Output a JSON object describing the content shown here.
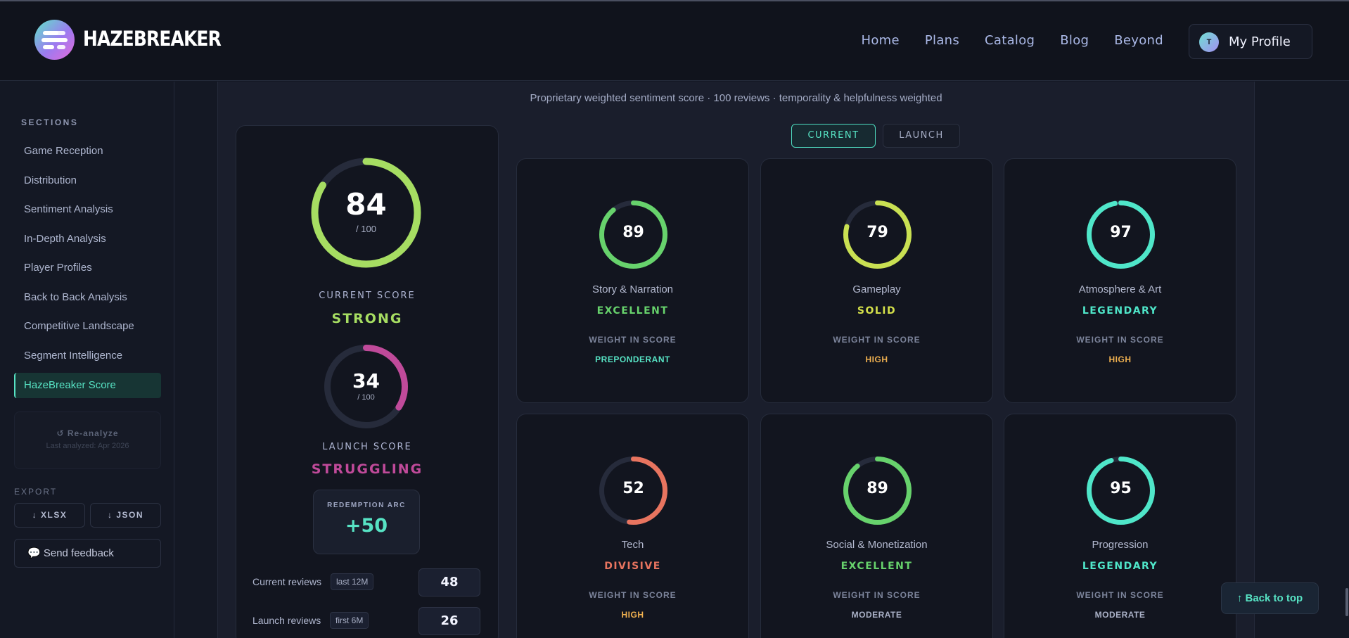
{
  "header": {
    "brand": "HAZEBREAKER",
    "nav": [
      "Home",
      "Plans",
      "Catalog",
      "Blog",
      "Beyond"
    ],
    "profile_initial": "T",
    "profile_label": "My Profile"
  },
  "sidebar": {
    "heading": "SECTIONS",
    "items": [
      {
        "label": "Game Reception"
      },
      {
        "label": "Distribution"
      },
      {
        "label": "Sentiment Analysis"
      },
      {
        "label": "In-Depth Analysis"
      },
      {
        "label": "Player Profiles"
      },
      {
        "label": "Back to Back Analysis"
      },
      {
        "label": "Competitive Landscape"
      },
      {
        "label": "Segment Intelligence"
      },
      {
        "label": "HazeBreaker Score",
        "active": true
      }
    ],
    "reanalyze_label": "↺ Re-analyze",
    "last_analyzed": "Last analyzed: Apr 2026",
    "export_heading": "EXPORT",
    "export_xlsx": "↓ XLSX",
    "export_json": "↓ JSON",
    "feedback_label": "💬 Send feedback"
  },
  "main": {
    "subtitle": "Proprietary weighted sentiment score · 100 reviews · temporality & helpfulness weighted",
    "toggle_current": "CURRENT",
    "toggle_launch": "LAUNCH"
  },
  "summary": {
    "current": {
      "value": 84,
      "denominator": "/ 100",
      "caption": "CURRENT SCORE",
      "verdict": "STRONG",
      "color": "#a6dd62"
    },
    "launch": {
      "value": 34,
      "denominator": "/ 100",
      "caption": "LAUNCH SCORE",
      "verdict": "STRUGGLING",
      "color": "#c04a9a"
    },
    "redemption_label": "REDEMPTION ARC",
    "redemption_value": "+50",
    "current_reviews_label": "Current reviews",
    "current_reviews_tag": "last 12M",
    "current_reviews_value": "48",
    "launch_reviews_label": "Launch reviews",
    "launch_reviews_tag": "first 6M",
    "launch_reviews_value": "26"
  },
  "categories": [
    {
      "value": 89,
      "name": "Story & Narration",
      "verdict": "EXCELLENT",
      "ring_color": "#67d26c",
      "verdict_color": "#67d26c",
      "weight_label": "WEIGHT IN SCORE",
      "weight": "PREPONDERANT",
      "weight_color": "#57e3c4"
    },
    {
      "value": 79,
      "name": "Gameplay",
      "verdict": "SOLID",
      "ring_color": "#c9e052",
      "verdict_color": "#d4e04a",
      "weight_label": "WEIGHT IN SCORE",
      "weight": "HIGH",
      "weight_color": "#f0b150"
    },
    {
      "value": 97,
      "name": "Atmosphere & Art",
      "verdict": "LEGENDARY",
      "ring_color": "#4fe6c9",
      "verdict_color": "#4fe6c9",
      "weight_label": "WEIGHT IN SCORE",
      "weight": "HIGH",
      "weight_color": "#f0b150"
    },
    {
      "value": 52,
      "name": "Tech",
      "verdict": "DIVISIVE",
      "ring_color": "#e8745f",
      "verdict_color": "#e8745f",
      "weight_label": "WEIGHT IN SCORE",
      "weight": "HIGH",
      "weight_color": "#f0b150"
    },
    {
      "value": 89,
      "name": "Social & Monetization",
      "verdict": "EXCELLENT",
      "ring_color": "#67d26c",
      "verdict_color": "#67d26c",
      "weight_label": "WEIGHT IN SCORE",
      "weight": "MODERATE",
      "weight_color": "#aab1c7"
    },
    {
      "value": 95,
      "name": "Progression",
      "verdict": "LEGENDARY",
      "ring_color": "#4fe6c9",
      "verdict_color": "#4fe6c9",
      "weight_label": "WEIGHT IN SCORE",
      "weight": "MODERATE",
      "weight_color": "#aab1c7"
    }
  ],
  "back_to_top": "↑ Back to top"
}
